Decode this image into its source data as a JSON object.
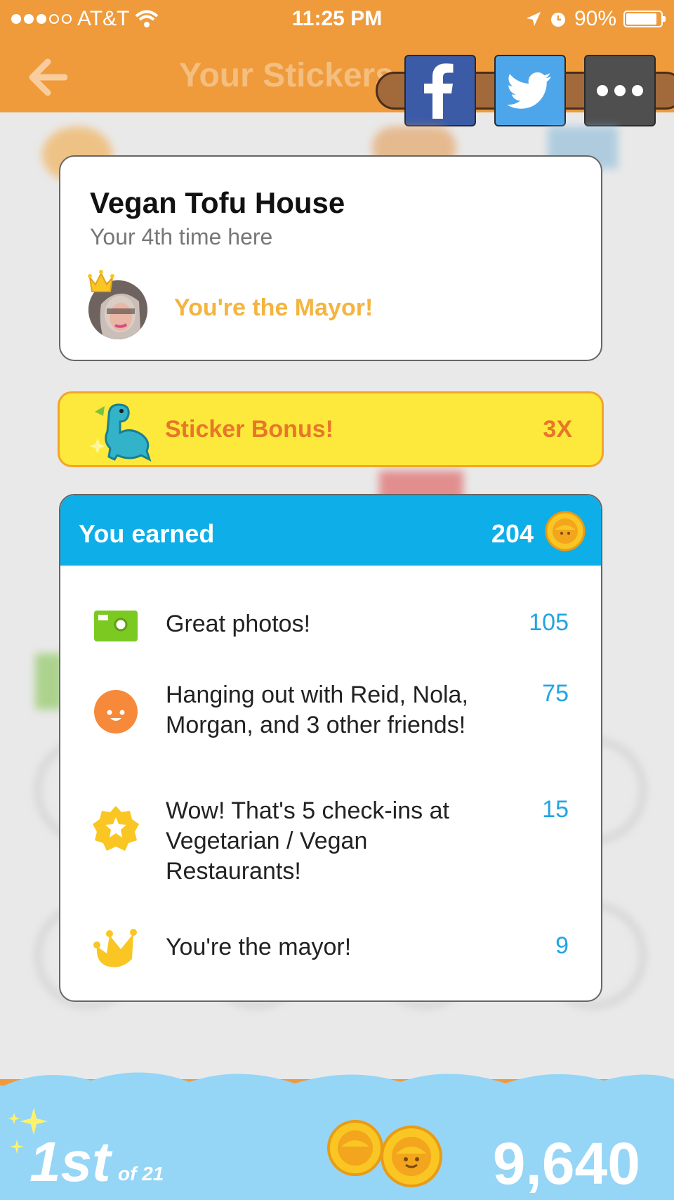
{
  "status_bar": {
    "carrier": "AT&T",
    "time": "11:25 PM",
    "battery": "90%",
    "battery_level": 0.9
  },
  "nav": {
    "title": "Your Stickers"
  },
  "venue": {
    "name": "Vegan Tofu House",
    "visits": "Your 4th time here",
    "mayor_text": "You're the Mayor!"
  },
  "bonus": {
    "label": "Sticker Bonus!",
    "multiplier": "3X"
  },
  "earned": {
    "title": "You earned",
    "total": "204",
    "items": [
      {
        "icon": "camera-icon",
        "text": "Great photos!",
        "points": "105"
      },
      {
        "icon": "smiley-face-icon",
        "text": "Hanging out with Reid, Nola, Morgan, and 3 other friends!",
        "points": "75"
      },
      {
        "icon": "star-badge-icon",
        "text": "Wow! That's 5 check-ins at Vegetarian / Vegan Restaurants!",
        "points": "15"
      },
      {
        "icon": "crown-icon",
        "text": "You're the mayor!",
        "points": "9"
      }
    ]
  },
  "leaderboard": {
    "rank": "1st",
    "of_total": "of 21",
    "coins": "9,640"
  },
  "colors": {
    "header_orange": "#ef9b3b",
    "earned_blue": "#0eaee8",
    "bonus_yellow": "#fde93b",
    "mayor_gold": "#f4b43f",
    "points_blue": "#21a5e0",
    "bottom_blue": "#95d5f6"
  }
}
